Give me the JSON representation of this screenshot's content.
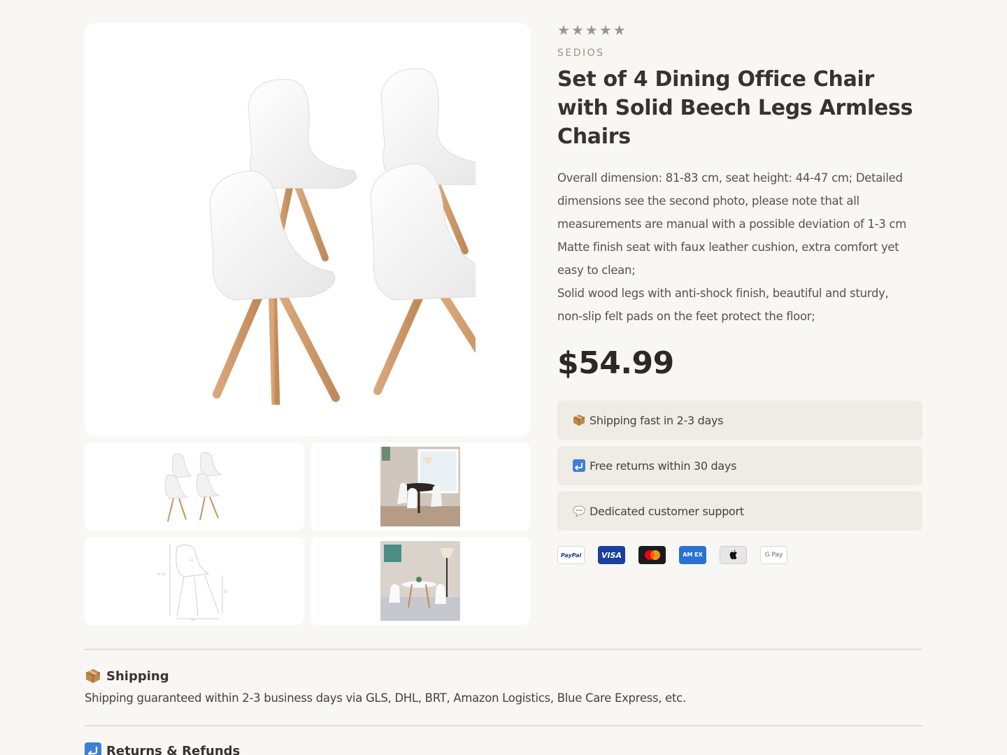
{
  "product": {
    "rating_stars": 5,
    "brand": "SEDIOS",
    "title": "Set of 4 Dining Office Chair with Solid Beech Legs Armless Chairs",
    "description_lines": [
      "Overall dimension: 81-83 cm, seat height: 44-47 cm; Detailed",
      "dimensions see the second photo, please note that all",
      "measurements are manual with a possible deviation of 1-3 cm",
      "Matte finish seat with faux leather cushion, extra comfort yet",
      "easy to clean;",
      "Solid wood legs with anti-shock finish, beautiful and sturdy,",
      "non-slip felt pads on the feet protect the floor;"
    ],
    "price": "$54.99"
  },
  "features": [
    {
      "icon": "package-icon",
      "label": "Shipping fast in 2-3 days"
    },
    {
      "icon": "return-arrow-icon",
      "label": "Free returns within 30 days"
    },
    {
      "icon": "speech-bubble-icon",
      "label": "Dedicated customer support"
    }
  ],
  "payments": [
    {
      "name": "paypal",
      "label": "PayPal"
    },
    {
      "name": "visa",
      "label": "VISA"
    },
    {
      "name": "mastercard",
      "label": ""
    },
    {
      "name": "amex",
      "label": "AM EX"
    },
    {
      "name": "apple-pay",
      "label": ""
    },
    {
      "name": "google-pay",
      "label": "G Pay"
    }
  ],
  "sections": {
    "shipping": {
      "title": "Shipping",
      "body": "Shipping guaranteed within 2-3 business days via GLS, DHL, BRT, Amazon Logistics, Blue Care Express, etc."
    },
    "returns": {
      "title": "Returns & Refunds"
    }
  },
  "gallery": {
    "thumbnails": [
      "four-chairs",
      "dining-room-scene",
      "dimension-drawing",
      "table-scene"
    ]
  },
  "colors": {
    "background": "#f8f7f4",
    "feature_bg": "#efebe5",
    "brand": "#a48f7e",
    "divider": "#e8ddd2"
  }
}
